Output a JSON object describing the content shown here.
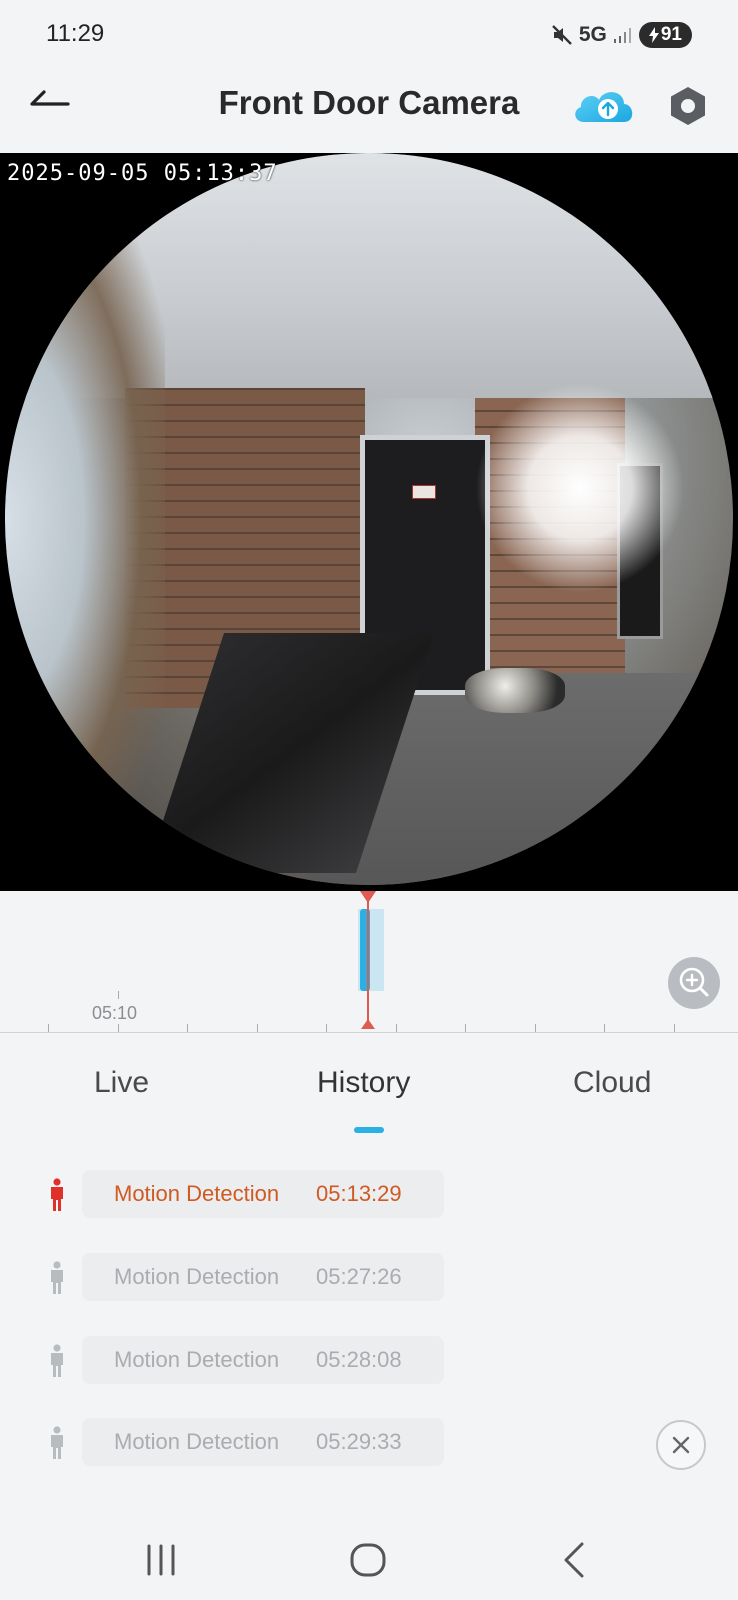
{
  "status_bar": {
    "time": "11:29",
    "network": "5G",
    "battery": "91",
    "icons": [
      "mute-icon",
      "signal-icon",
      "charging-icon"
    ]
  },
  "header": {
    "title": "Front Door Camera",
    "icons": [
      "back-arrow-icon",
      "cloud-upload-icon",
      "hexagon-settings-icon"
    ]
  },
  "video": {
    "timestamp": "2025-09-05 05:13:37"
  },
  "timeline": {
    "tick_label": "05:10",
    "icons": [
      "zoom-in-icon"
    ]
  },
  "tabs": [
    {
      "label": "Live"
    },
    {
      "label": "History"
    },
    {
      "label": "Cloud"
    }
  ],
  "events": [
    {
      "label": "Motion Detection",
      "time": "05:13:29",
      "active": true
    },
    {
      "label": "Motion Detection",
      "time": "05:27:26",
      "active": false
    },
    {
      "label": "Motion Detection",
      "time": "05:28:08",
      "active": false
    },
    {
      "label": "Motion Detection",
      "time": "05:29:33",
      "active": false
    }
  ],
  "colors": {
    "accent": "#2bb0e4",
    "playhead": "#e05a4f",
    "active_event": "#cf5a22",
    "active_person_icon": "#e0302a",
    "inactive": "#a9acb0"
  },
  "nav": {
    "icons": [
      "recents-icon",
      "home-icon",
      "back-icon"
    ]
  }
}
